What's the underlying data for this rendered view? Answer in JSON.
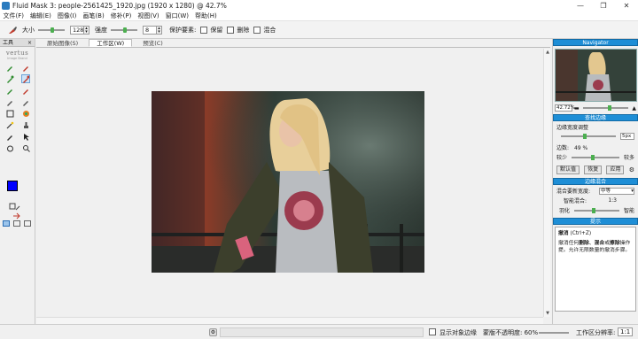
{
  "window": {
    "title": "Fluid Mask 3: people-2561425_1920.jpg (1920 x 1280) @ 42.7%",
    "controls": [
      "—",
      "❐",
      "✕"
    ]
  },
  "menu": [
    "文件(F)",
    "编辑(E)",
    "图像(I)",
    "画笔(B)",
    "修补(P)",
    "视图(V)",
    "窗口(W)",
    "帮助(H)"
  ],
  "toolbar": {
    "size_label": "大小",
    "size_value": "128",
    "feather_label": "强度",
    "feather_value": "8",
    "protect_label": "保护要素:",
    "keep_label": "保留",
    "delete_label": "删除",
    "blend_label": "混合"
  },
  "left_panel": {
    "header": "工具",
    "logo": "vertus",
    "logo_sub": "Image Brand"
  },
  "tabs": [
    "原始图像(S)",
    "工作区(W)",
    "预览(C)"
  ],
  "active_tab": 1,
  "navigator": {
    "header": "Navigator",
    "zoom": "42.72%"
  },
  "edge_panel": {
    "header": "查找边缘",
    "width_label": "边缘宽度调整",
    "width_value": "5px",
    "factor_label": "边数:",
    "factor_value": "49 %",
    "less_label": "较少",
    "more_label": "较多",
    "default_btn": "默认值",
    "restore_btn": "恢复",
    "apply_btn": "应用"
  },
  "blend_panel": {
    "header": "边缘混合",
    "quality_label": "混合要新宽度:",
    "quality_value": "中等",
    "smart_label": "智能混合:",
    "smart_value": "1:3",
    "soft_label": "羽化",
    "smart_right": "智能"
  },
  "hint_panel": {
    "header": "提示",
    "line1_bold": "撤消",
    "line1_rest": " (Ctrl+Z)",
    "line2_a": "撤消任何",
    "line2_b": "删除",
    "line2_c": "、",
    "line2_d": "混合",
    "line2_e": "或",
    "line2_f": "擦除",
    "line2_g": "操作",
    "line3": "提。允许无限数量的撤消步骤。"
  },
  "status": {
    "show_edges": "显示对象边缘",
    "opacity": "蒙版不透明度: 60%",
    "zoom_label": "工作区分辨率:",
    "zoom_value": "1:1"
  },
  "colors": {
    "accent": "#1e8ed6",
    "foreground": "#0000ff"
  }
}
